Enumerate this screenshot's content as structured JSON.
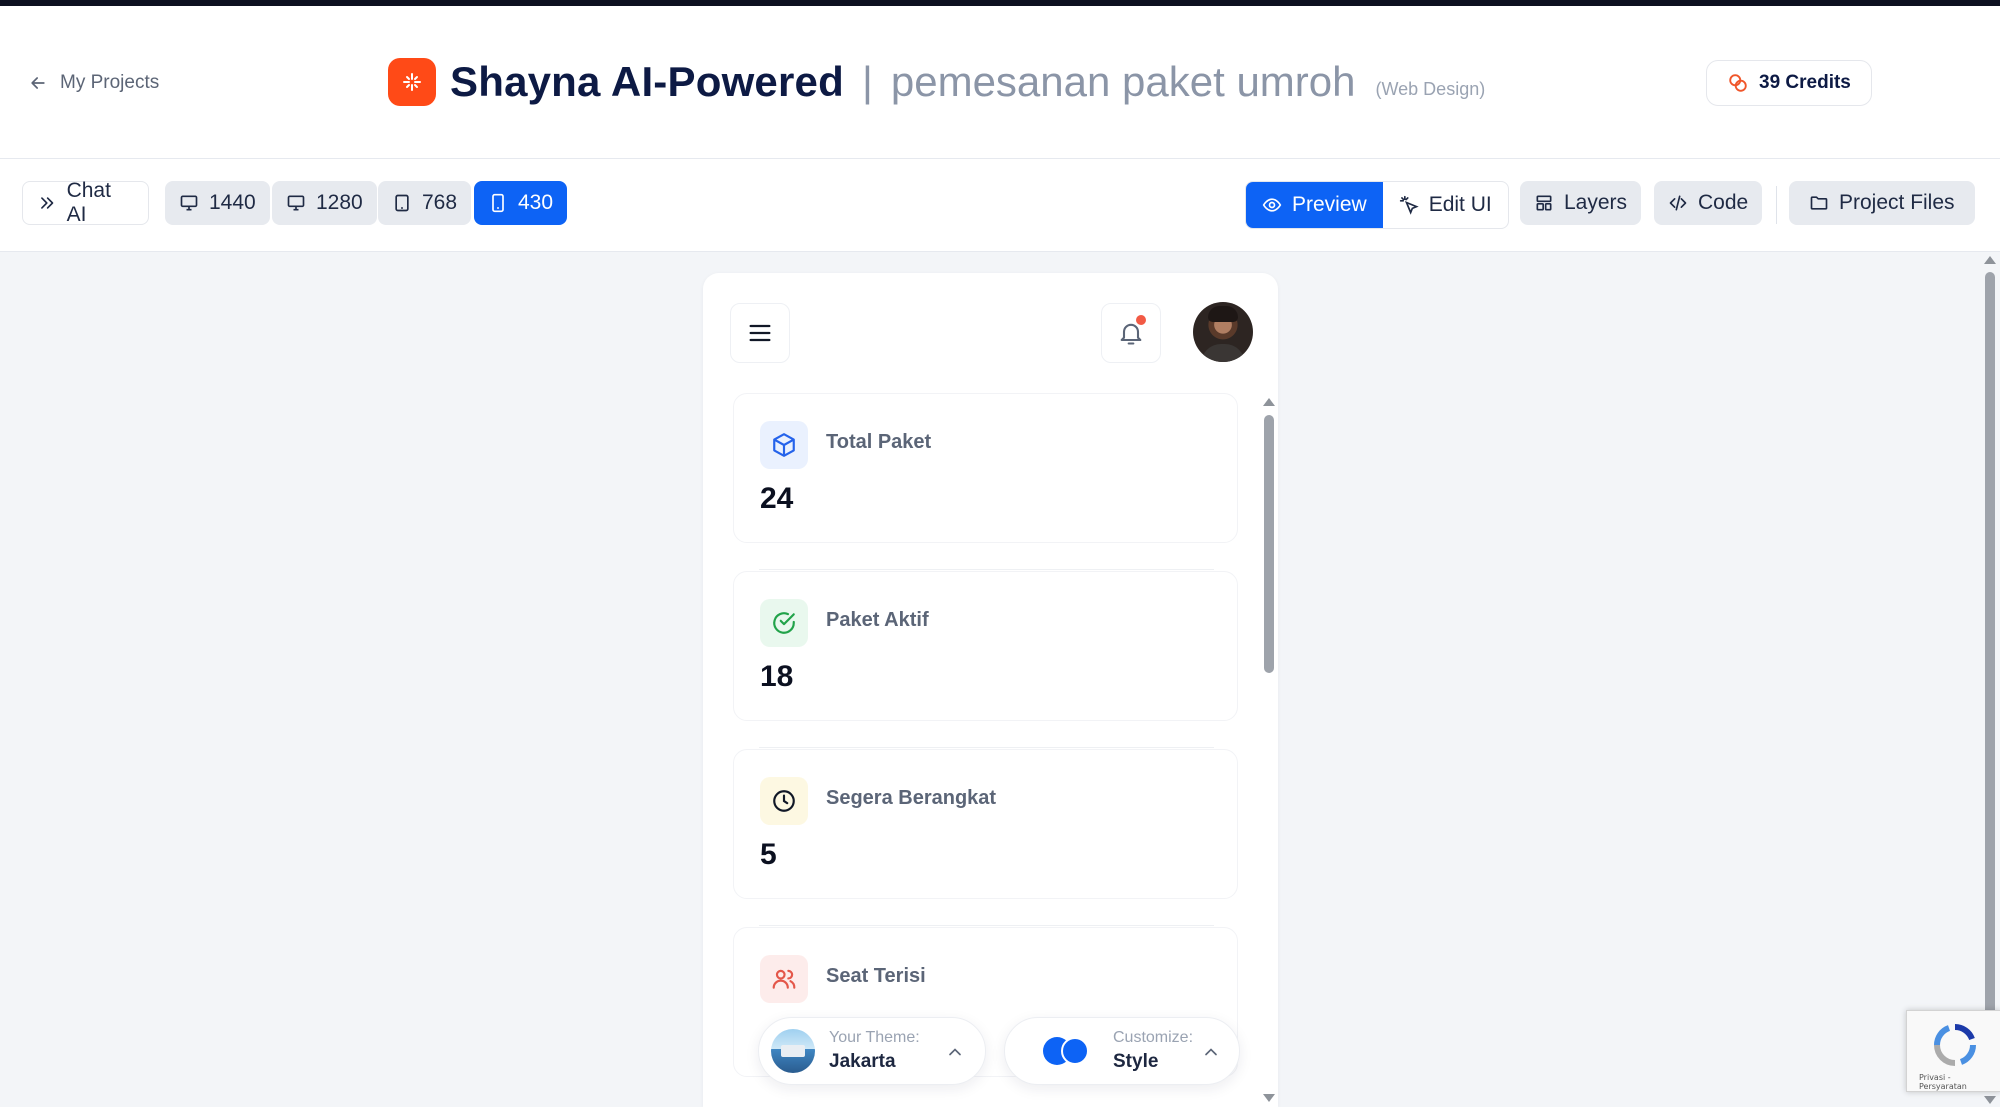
{
  "header": {
    "back_label": "My Projects",
    "title_main": "Shayna AI-Powered",
    "title_sep": "|",
    "title_sub": "pemesanan paket umroh",
    "title_type": "(Web Design)",
    "credits_label": "39 Credits"
  },
  "toolbar": {
    "chat_label": "Chat AI",
    "viewports": [
      "1440",
      "1280",
      "768",
      "430"
    ],
    "active_viewport": "430",
    "preview_label": "Preview",
    "edit_label": "Edit UI",
    "layers_label": "Layers",
    "code_label": "Code",
    "files_label": "Project Files"
  },
  "preview": {
    "stats": [
      {
        "label": "Total Paket",
        "value": "24",
        "icon": "package-icon"
      },
      {
        "label": "Paket Aktif",
        "value": "18",
        "icon": "check-circle-icon"
      },
      {
        "label": "Segera Berangkat",
        "value": "5",
        "icon": "clock-icon"
      },
      {
        "label": "Seat Terisi",
        "value": "",
        "icon": "users-icon"
      }
    ]
  },
  "theme": {
    "key": "Your Theme:",
    "value": "Jakarta"
  },
  "customize": {
    "key": "Customize:",
    "value": "Style"
  },
  "recaptcha": {
    "text": "Privasi - Persyaratan"
  },
  "colors": {
    "accent": "#0d63f5",
    "brand": "#ff4a17",
    "notification": "#f25a45"
  }
}
